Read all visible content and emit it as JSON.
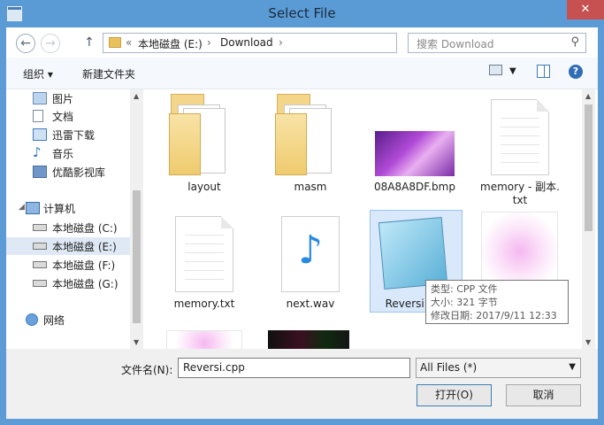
{
  "window": {
    "title": "Select File",
    "close_glyph": "✕"
  },
  "address": {
    "back_glyph": "←",
    "forward_glyph": "→",
    "up_glyph": "↑",
    "chevron": "«",
    "drive": "本地磁盘 (E:)",
    "sep": "›",
    "folder": "Download",
    "refresh_glyph": "↻"
  },
  "search": {
    "placeholder": "搜索 Download",
    "icon_glyph": "⚲"
  },
  "toolbar": {
    "organize": "组织 ▾",
    "new_folder": "新建文件夹",
    "help": "?"
  },
  "nav": {
    "items": [
      {
        "label": "图片",
        "icon": "pictures-icon"
      },
      {
        "label": "文档",
        "icon": "documents-icon"
      },
      {
        "label": "迅雷下载",
        "icon": "download-icon"
      },
      {
        "label": "音乐",
        "icon": "music-icon"
      },
      {
        "label": "优酷影视库",
        "icon": "video-icon"
      }
    ],
    "computer": "计算机",
    "drives": [
      "本地磁盘 (C:)",
      "本地磁盘 (E:)",
      "本地磁盘 (F:)",
      "本地磁盘 (G:)"
    ],
    "selected_drive": "本地磁盘 (E:)",
    "network": "网络"
  },
  "files": [
    {
      "name": "layout",
      "type": "folder"
    },
    {
      "name": "masm",
      "type": "folder"
    },
    {
      "name": "08A8A8DF.bmp",
      "type": "image"
    },
    {
      "name": "memory - 副本.\ntxt",
      "type": "text"
    },
    {
      "name": "memory.txt",
      "type": "text"
    },
    {
      "name": "next.wav",
      "type": "audio"
    },
    {
      "name": "Reversi.cpp",
      "type": "cpp",
      "selected": true
    },
    {
      "name": "",
      "type": "image"
    }
  ],
  "tooltip": {
    "type": "类型: CPP 文件",
    "size": "大小: 321 字节",
    "modified": "修改日期: 2017/9/11 12:33"
  },
  "footer": {
    "filename_label": "文件名(N):",
    "filename_value": "Reversi.cpp",
    "filetype": "All Files  (*)",
    "open": "打开(O)",
    "cancel": "取消"
  },
  "colors": {
    "titlebar": "#5b9bd5",
    "close": "#c75050",
    "selection": "#d9e8fb"
  }
}
